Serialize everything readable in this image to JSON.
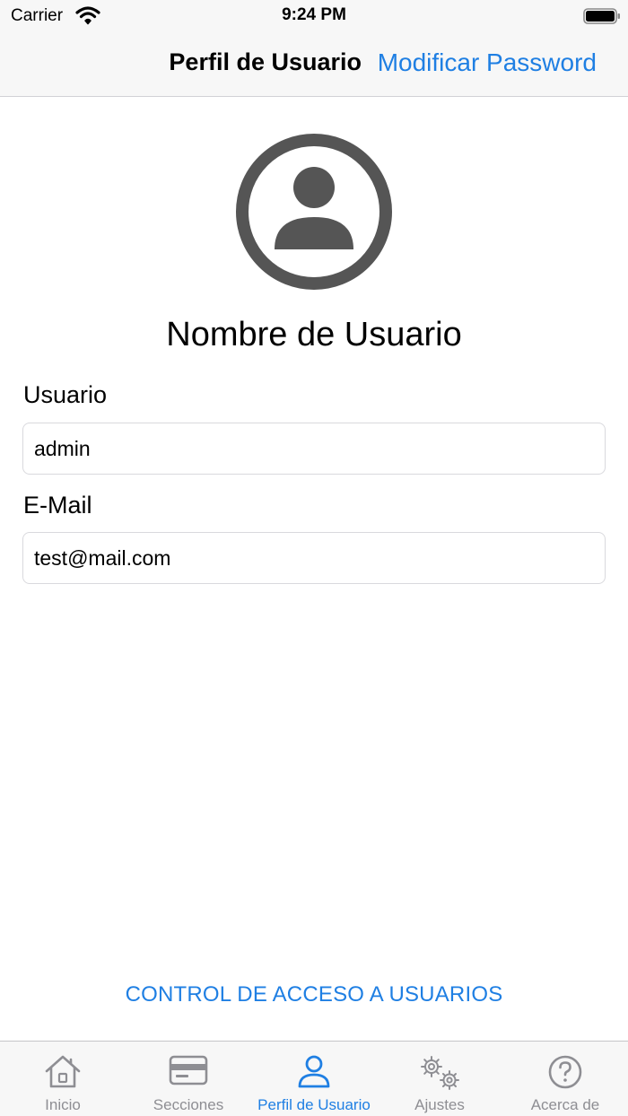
{
  "status_bar": {
    "carrier": "Carrier",
    "time": "9:24 PM"
  },
  "nav": {
    "title": "Perfil de Usuario",
    "action": "Modificar Password"
  },
  "profile": {
    "name": "Nombre de Usuario",
    "fields": {
      "usuario": {
        "label": "Usuario",
        "value": "admin"
      },
      "email": {
        "label": "E-Mail",
        "value": "test@mail.com"
      }
    }
  },
  "access_control": {
    "label": "CONTROL DE ACCESO A USUARIOS"
  },
  "tabs": [
    {
      "label": "Inicio",
      "icon": "home-icon",
      "active": false
    },
    {
      "label": "Secciones",
      "icon": "card-icon",
      "active": false
    },
    {
      "label": "Perfil de Usuario",
      "icon": "person-icon",
      "active": true
    },
    {
      "label": "Ajustes",
      "icon": "gears-icon",
      "active": false
    },
    {
      "label": "Acerca de",
      "icon": "question-circle-icon",
      "active": false
    }
  ],
  "colors": {
    "accent": "#1f7fe3",
    "inactive": "#8e8e93",
    "bar_bg": "#f7f7f7",
    "avatar": "#555555"
  }
}
